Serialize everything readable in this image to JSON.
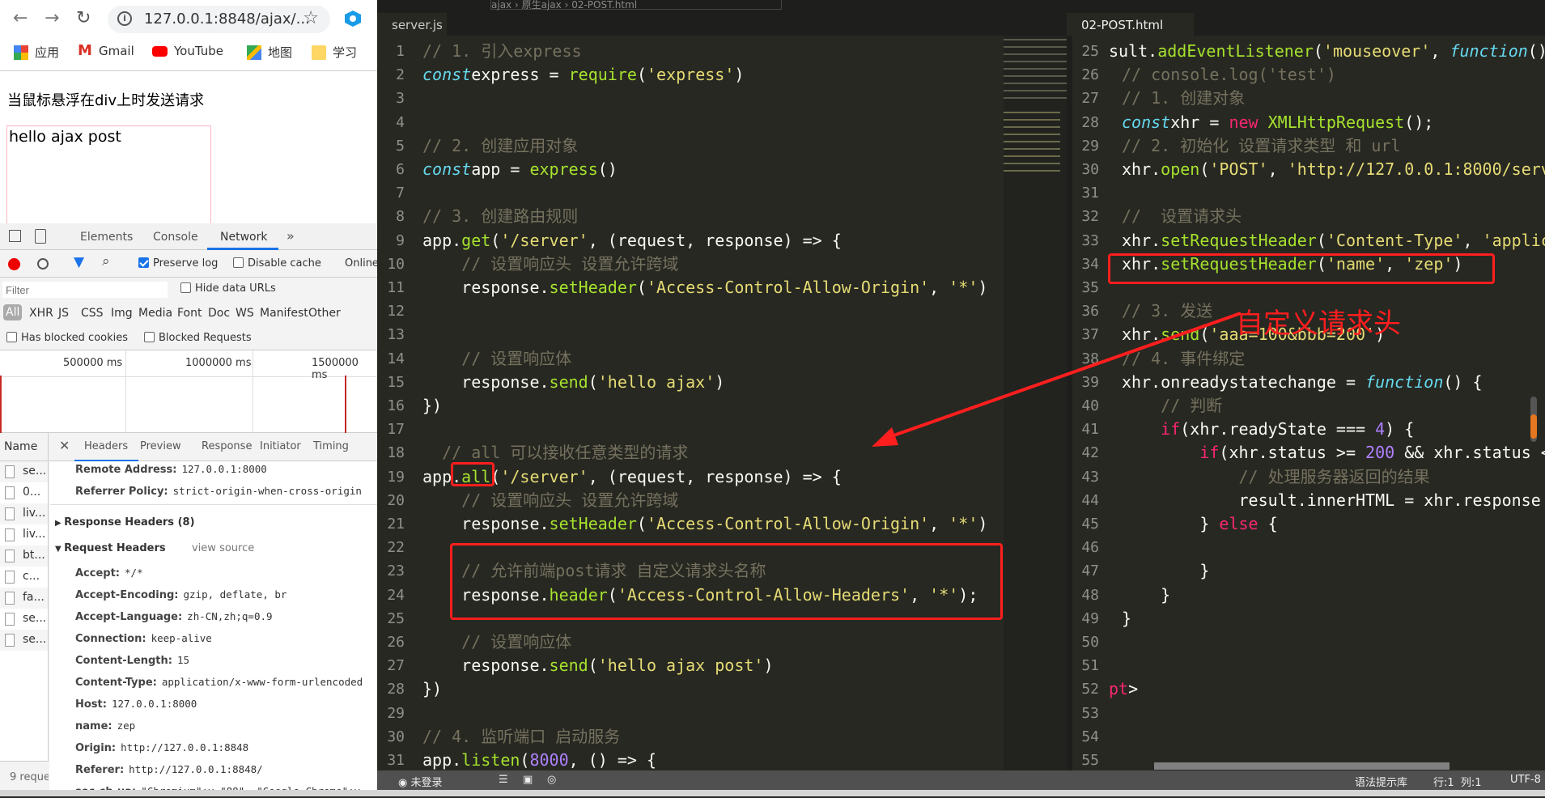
{
  "browser": {
    "url": "127.0.0.1:8848/ajax/...",
    "bookmarks": [
      "应用",
      "Gmail",
      "YouTube",
      "地图",
      "学习"
    ],
    "heading": "当鼠标悬浮在div上时发送请求",
    "result_text": "hello ajax post"
  },
  "devtools": {
    "tabs": [
      "Elements",
      "Console",
      "Network"
    ],
    "active_tab": "Network",
    "more": "»",
    "preserve_log": "Preserve log",
    "preserve_log_checked": true,
    "disable_cache": "Disable cache",
    "throttle": "Online",
    "filter_placeholder": "Filter",
    "hide_data_urls": "Hide data URLs",
    "types": [
      "All",
      "XHR",
      "JS",
      "CSS",
      "Img",
      "Media",
      "Font",
      "Doc",
      "WS",
      "Manifest",
      "Other"
    ],
    "has_blocked_cookies": "Has blocked cookies",
    "blocked_requests": "Blocked Requests",
    "timeline_ticks": [
      "500000 ms",
      "1000000 ms",
      "1500000 ms"
    ],
    "name_header": "Name",
    "requests": [
      "se...",
      "0...",
      "liv...",
      "liv...",
      "bt...",
      "c...",
      "fa...",
      "se...",
      "se..."
    ],
    "footer": "9 reque",
    "detail_tabs": [
      "Headers",
      "Preview",
      "Response",
      "Initiator",
      "Timing"
    ],
    "general": [
      {
        "k": "Remote Address:",
        "v": "127.0.0.1:8000"
      },
      {
        "k": "Referrer Policy:",
        "v": "strict-origin-when-cross-origin"
      }
    ],
    "response_headers": "Response Headers (8)",
    "request_headers": "Request Headers",
    "view_source": "view source",
    "headers": [
      {
        "k": "Accept:",
        "v": "*/*"
      },
      {
        "k": "Accept-Encoding:",
        "v": "gzip, deflate, br"
      },
      {
        "k": "Accept-Language:",
        "v": "zh-CN,zh;q=0.9"
      },
      {
        "k": "Connection:",
        "v": "keep-alive"
      },
      {
        "k": "Content-Length:",
        "v": "15"
      },
      {
        "k": "Content-Type:",
        "v": "application/x-www-form-urlencoded"
      },
      {
        "k": "Host:",
        "v": "127.0.0.1:8000"
      },
      {
        "k": "name:",
        "v": "zep"
      },
      {
        "k": "Origin:",
        "v": "http://127.0.0.1:8848"
      },
      {
        "k": "Referer:",
        "v": "http://127.0.0.1:8848/"
      },
      {
        "k": "sec-ch-ua:",
        "v": "\"Chromium\";v=\"88\", \"Google Chrome\";v"
      }
    ]
  },
  "editor": {
    "breadcrumb": [
      "ajax",
      "原生ajax",
      "02-POST.html"
    ],
    "left_tab": "server.js",
    "right_tab": "02-POST.html",
    "annotation": "自定义请求头",
    "left_start": 1,
    "left_lines": [
      [
        [
          "c",
          "// 1. 引入express"
        ]
      ],
      [
        [
          "k",
          "const"
        ],
        [
          "",
          "express = "
        ],
        [
          "f",
          "require"
        ],
        [
          "",
          "("
        ],
        [
          "s",
          "'express'"
        ],
        [
          "",
          ")"
        ]
      ],
      [],
      [],
      [
        [
          "c",
          "// 2. 创建应用对象"
        ]
      ],
      [
        [
          "k",
          "const"
        ],
        [
          "",
          "app = "
        ],
        [
          "f",
          "express"
        ],
        [
          "",
          "()"
        ]
      ],
      [],
      [
        [
          "c",
          "// 3. 创建路由规则"
        ]
      ],
      [
        [
          "",
          "app."
        ],
        [
          "f",
          "get"
        ],
        [
          "",
          "("
        ],
        [
          "s",
          "'/server'"
        ],
        [
          "",
          ", (request, response) => {"
        ]
      ],
      [
        [
          "",
          "    "
        ],
        [
          "c",
          "// 设置响应头 设置允许跨域"
        ]
      ],
      [
        [
          "",
          "    response."
        ],
        [
          "f",
          "setHeader"
        ],
        [
          "",
          "("
        ],
        [
          "s",
          "'Access-Control-Allow-Origin'"
        ],
        [
          "",
          ", "
        ],
        [
          "s",
          "'*'"
        ],
        [
          "",
          ")"
        ]
      ],
      [],
      [],
      [
        [
          "",
          "    "
        ],
        [
          "c",
          "// 设置响应体"
        ]
      ],
      [
        [
          "",
          "    response."
        ],
        [
          "f",
          "send"
        ],
        [
          "",
          "("
        ],
        [
          "s",
          "'hello ajax'"
        ],
        [
          "",
          ")"
        ]
      ],
      [
        [
          "",
          "})"
        ]
      ],
      [],
      [
        [
          "",
          "  "
        ],
        [
          "c",
          "// all 可以接收任意类型的请求"
        ]
      ],
      [
        [
          "",
          "app."
        ],
        [
          "f",
          "all"
        ],
        [
          "",
          "("
        ],
        [
          "s",
          "'/server'"
        ],
        [
          "",
          ", (request, response) => {"
        ]
      ],
      [
        [
          "",
          "    "
        ],
        [
          "c",
          "// 设置响应头 设置允许跨域"
        ]
      ],
      [
        [
          "",
          "    response."
        ],
        [
          "f",
          "setHeader"
        ],
        [
          "",
          "("
        ],
        [
          "s",
          "'Access-Control-Allow-Origin'"
        ],
        [
          "",
          ", "
        ],
        [
          "s",
          "'*'"
        ],
        [
          "",
          ")"
        ]
      ],
      [],
      [
        [
          "",
          "    "
        ],
        [
          "c",
          "// 允许前端post请求 自定义请求头名称"
        ]
      ],
      [
        [
          "",
          "    response."
        ],
        [
          "f",
          "header"
        ],
        [
          "",
          "("
        ],
        [
          "s",
          "'Access-Control-Allow-Headers'"
        ],
        [
          "",
          ", "
        ],
        [
          "s",
          "'*'"
        ],
        [
          "",
          ");"
        ]
      ],
      [],
      [
        [
          "",
          "    "
        ],
        [
          "c",
          "// 设置响应体"
        ]
      ],
      [
        [
          "",
          "    response."
        ],
        [
          "f",
          "send"
        ],
        [
          "",
          "("
        ],
        [
          "s",
          "'hello ajax post'"
        ],
        [
          "",
          ")"
        ]
      ],
      [
        [
          "",
          "})"
        ]
      ],
      [],
      [
        [
          "c",
          "// 4. 监听端口 启动服务"
        ]
      ],
      [
        [
          "",
          "app."
        ],
        [
          "f",
          "listen"
        ],
        [
          "",
          "("
        ],
        [
          "n",
          "8000"
        ],
        [
          "",
          ", () => {"
        ]
      ]
    ],
    "right_start": 25,
    "right_lines": [
      [
        [
          "",
          "sult."
        ],
        [
          "f",
          "addEventListener"
        ],
        [
          "",
          "("
        ],
        [
          "s",
          "'mouseover'"
        ],
        [
          "",
          ", "
        ],
        [
          "k",
          "function"
        ],
        [
          "",
          "()"
        ]
      ],
      [
        [
          "c",
          "// console.log('test')"
        ]
      ],
      [
        [
          "c",
          "// 1. 创建对象"
        ]
      ],
      [
        [
          "k",
          "const"
        ],
        [
          "",
          "xhr = "
        ],
        [
          "p",
          "new"
        ],
        [
          "",
          " "
        ],
        [
          "f",
          "XMLHttpRequest"
        ],
        [
          "",
          "();"
        ]
      ],
      [
        [
          "c",
          "// 2. 初始化 设置请求类型 和 url"
        ]
      ],
      [
        [
          "",
          "xhr."
        ],
        [
          "f",
          "open"
        ],
        [
          "",
          "("
        ],
        [
          "s",
          "'POST'"
        ],
        [
          "",
          ", "
        ],
        [
          "s",
          "'http://127.0.0.1:8000/serv"
        ]
      ],
      [],
      [
        [
          "c",
          "//  设置请求头"
        ]
      ],
      [
        [
          "",
          "xhr."
        ],
        [
          "f",
          "setRequestHeader"
        ],
        [
          "",
          "("
        ],
        [
          "s",
          "'Content-Type'"
        ],
        [
          "",
          ", "
        ],
        [
          "s",
          "'applic"
        ]
      ],
      [
        [
          "",
          "xhr."
        ],
        [
          "f",
          "setRequestHeader"
        ],
        [
          "",
          "("
        ],
        [
          "s",
          "'name'"
        ],
        [
          "",
          ", "
        ],
        [
          "s",
          "'zep'"
        ],
        [
          "",
          ")"
        ]
      ],
      [],
      [
        [
          "c",
          "// 3. 发送"
        ]
      ],
      [
        [
          "",
          "xhr."
        ],
        [
          "f",
          "send"
        ],
        [
          "",
          "("
        ],
        [
          "s",
          "'aaa=100&bbb=200'"
        ],
        [
          "",
          ")"
        ]
      ],
      [
        [
          "c",
          "// 4. 事件绑定"
        ]
      ],
      [
        [
          "",
          "xhr.onreadystatechange = "
        ],
        [
          "k",
          "function"
        ],
        [
          "",
          "() {"
        ]
      ],
      [
        [
          "",
          "    "
        ],
        [
          "c",
          "// 判断"
        ]
      ],
      [
        [
          "",
          "    "
        ],
        [
          "p",
          "if"
        ],
        [
          "",
          "(xhr.readyState === "
        ],
        [
          "n",
          "4"
        ],
        [
          "",
          ") {"
        ]
      ],
      [
        [
          "",
          "        "
        ],
        [
          "p",
          "if"
        ],
        [
          "",
          "(xhr.status >= "
        ],
        [
          "n",
          "200"
        ],
        [
          "",
          " && xhr.status <"
        ]
      ],
      [
        [
          "",
          "            "
        ],
        [
          "c",
          "// 处理服务器返回的结果"
        ]
      ],
      [
        [
          "",
          "            result.innerHTML = xhr.response"
        ]
      ],
      [
        [
          "",
          "        } "
        ],
        [
          "p",
          "else"
        ],
        [
          "",
          " {"
        ]
      ],
      [],
      [
        [
          "",
          "        }"
        ]
      ],
      [
        [
          "",
          "    }"
        ]
      ],
      [
        [
          "",
          "}"
        ]
      ],
      [],
      [],
      [
        [
          "p",
          "pt"
        ],
        [
          "",
          ">"
        ]
      ],
      [],
      [],
      []
    ]
  },
  "status": {
    "login": "未登录",
    "syntax": "语法提示库",
    "position": "行:1  列:1",
    "encoding": "UTF-8"
  },
  "colors": {
    "editor_bg": "#272822",
    "annotation": "#ff1e1e",
    "network_accent": "#1a73e8"
  }
}
